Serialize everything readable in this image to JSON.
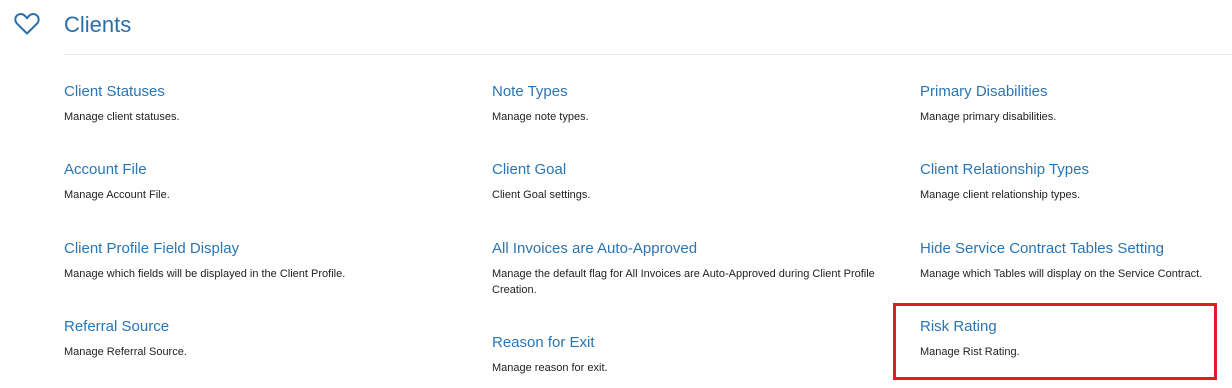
{
  "section": {
    "title": "Clients",
    "icon": "heart-outline-icon"
  },
  "items": [
    {
      "title": "Client Statuses",
      "desc": "Manage client statuses."
    },
    {
      "title": "Note Types",
      "desc": "Manage note types."
    },
    {
      "title": "Primary Disabilities",
      "desc": "Manage primary disabilities."
    },
    {
      "title": "Account File",
      "desc": "Manage Account File."
    },
    {
      "title": "Client Goal",
      "desc": "Client Goal settings."
    },
    {
      "title": "Client Relationship Types",
      "desc": "Manage client relationship types."
    },
    {
      "title": "Client Profile Field Display",
      "desc": "Manage which fields will be displayed in the Client Profile."
    },
    {
      "title": "All Invoices are Auto-Approved",
      "desc": "Manage the default flag for All Invoices are Auto-Approved during Client Profile Creation."
    },
    {
      "title": "Hide Service Contract Tables Setting",
      "desc": "Manage which Tables will display on the Service Contract."
    },
    {
      "title": "Referral Source",
      "desc": "Manage Referral Source."
    },
    {
      "title": "Reason for Exit",
      "desc": "Manage reason for exit."
    },
    {
      "title": "Risk Rating",
      "desc": "Manage Rist Rating."
    }
  ],
  "colors": {
    "link": "#2a75b3",
    "title": "#2a6fa8",
    "highlight": "#e01b24"
  }
}
